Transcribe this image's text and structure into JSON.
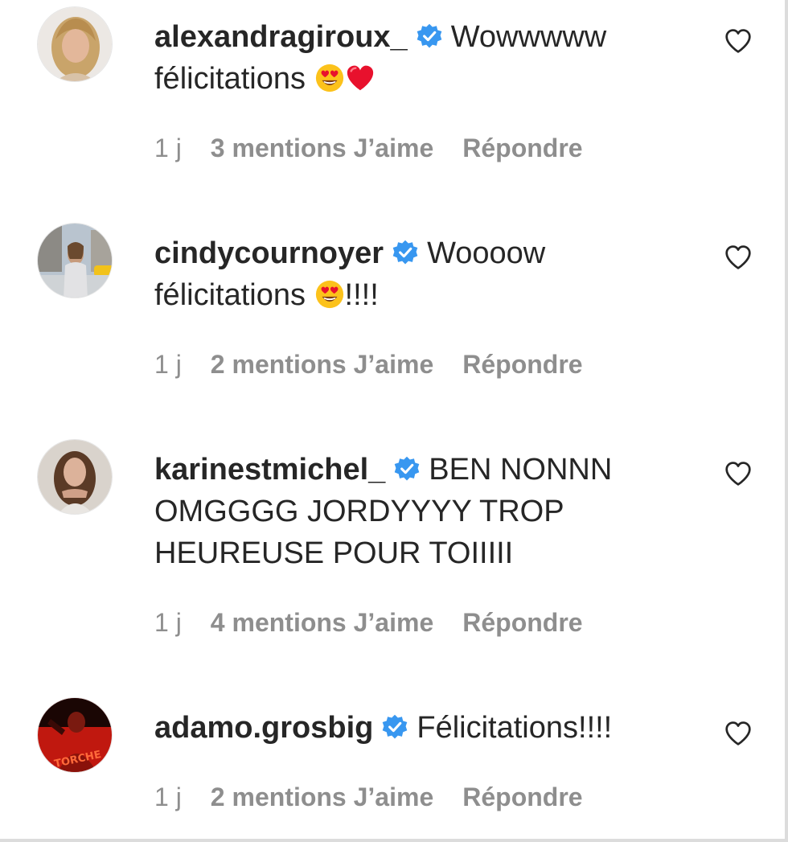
{
  "comments": [
    {
      "username": "alexandragiroux_",
      "verified": true,
      "text_line1": "Wowwwww",
      "text_line2": "félicitations",
      "text_line3": "",
      "emojis": [
        "heart-eyes",
        "red-heart"
      ],
      "time": "1 j",
      "likes": "3 mentions J’aime",
      "reply": "Répondre"
    },
    {
      "username": "cindycournoyer",
      "verified": true,
      "text_line1": "Woooow",
      "text_line2": "félicitations",
      "text_suffix": "!!!!",
      "emojis": [
        "heart-eyes"
      ],
      "time": "1 j",
      "likes": "2 mentions J’aime",
      "reply": "Répondre"
    },
    {
      "username": "karinestmichel_",
      "verified": true,
      "text_line1": "BEN NONNN",
      "text_line2": "OMGGGG JORDYYYY TROP",
      "text_line3": "HEUREUSE POUR TOIIIII",
      "emojis": [],
      "time": "1 j",
      "likes": "4 mentions J’aime",
      "reply": "Répondre"
    },
    {
      "username": "adamo.grosbig",
      "verified": true,
      "text_line1": "Félicitations!!!!",
      "emojis": [],
      "time": "1 j",
      "likes": "2 mentions J’aime",
      "reply": "Répondre"
    }
  ],
  "colors": {
    "text": "#262626",
    "meta": "#8e8e8e",
    "verified": "#3897f0",
    "heart_emoji": "#e8112d"
  },
  "icons": {
    "verified": "verified-badge-icon",
    "like": "heart-outline-icon"
  }
}
